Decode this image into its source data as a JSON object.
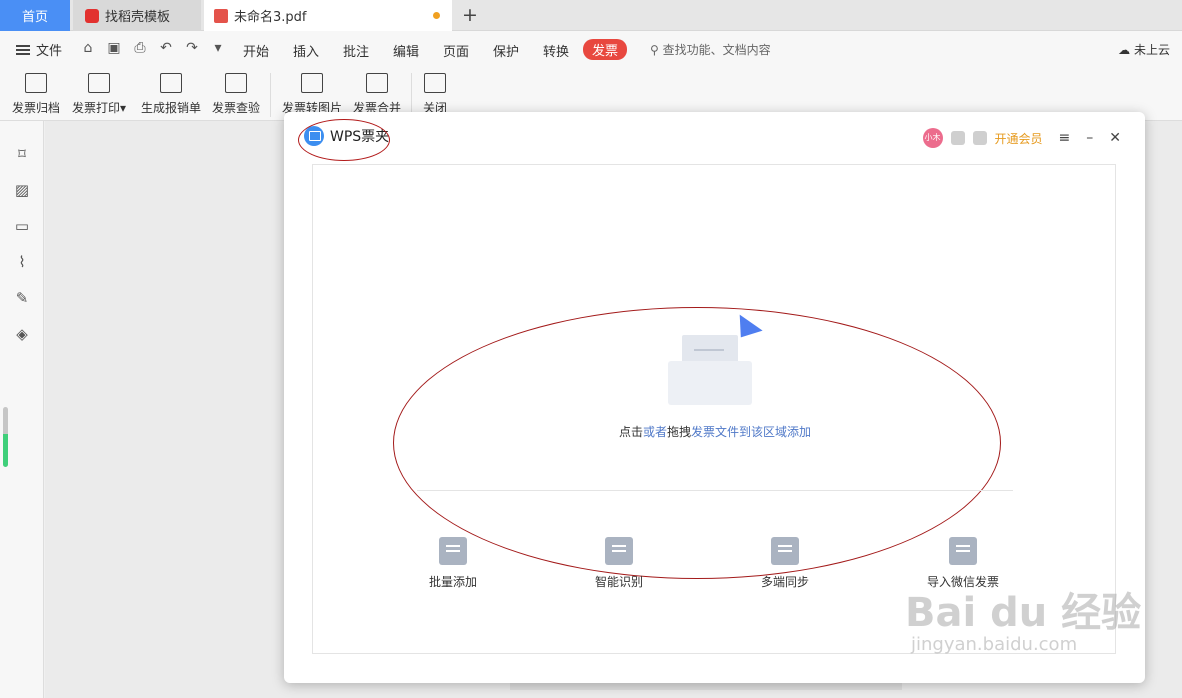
{
  "tabs": {
    "home": "首页",
    "template": "找稻壳模板",
    "pdf": "未命名3.pdf",
    "new_tab": "+"
  },
  "menu": {
    "file": "文件",
    "items": [
      "开始",
      "插入",
      "批注",
      "编辑",
      "页面",
      "保护",
      "转换",
      "发票"
    ],
    "active": "发票",
    "search_placeholder": "查找功能、文档内容",
    "cloud": "未上云"
  },
  "ribbon": {
    "buttons": [
      "发票归档",
      "发票打印",
      "生成报销单",
      "发票查验",
      "发票转图片",
      "发票合并",
      "关闭"
    ]
  },
  "dialog": {
    "title": "WPS票夹",
    "avatar_text": "小木",
    "vip": "开通会员",
    "drop_text": {
      "part1": "点击",
      "part2": "或者",
      "part3": "拖拽",
      "part4": "发票文件到该区域添加"
    },
    "features": [
      "批量添加",
      "智能识别",
      "多端同步",
      "导入微信发票"
    ]
  },
  "watermark": {
    "main": "Bai du 经验",
    "sub": "jingyan.baidu.com"
  },
  "colors": {
    "accent": "#4a8ff5",
    "invoice_tab": "#e8483f",
    "vip": "#e69a1e",
    "annotation": "#a31a1a"
  }
}
